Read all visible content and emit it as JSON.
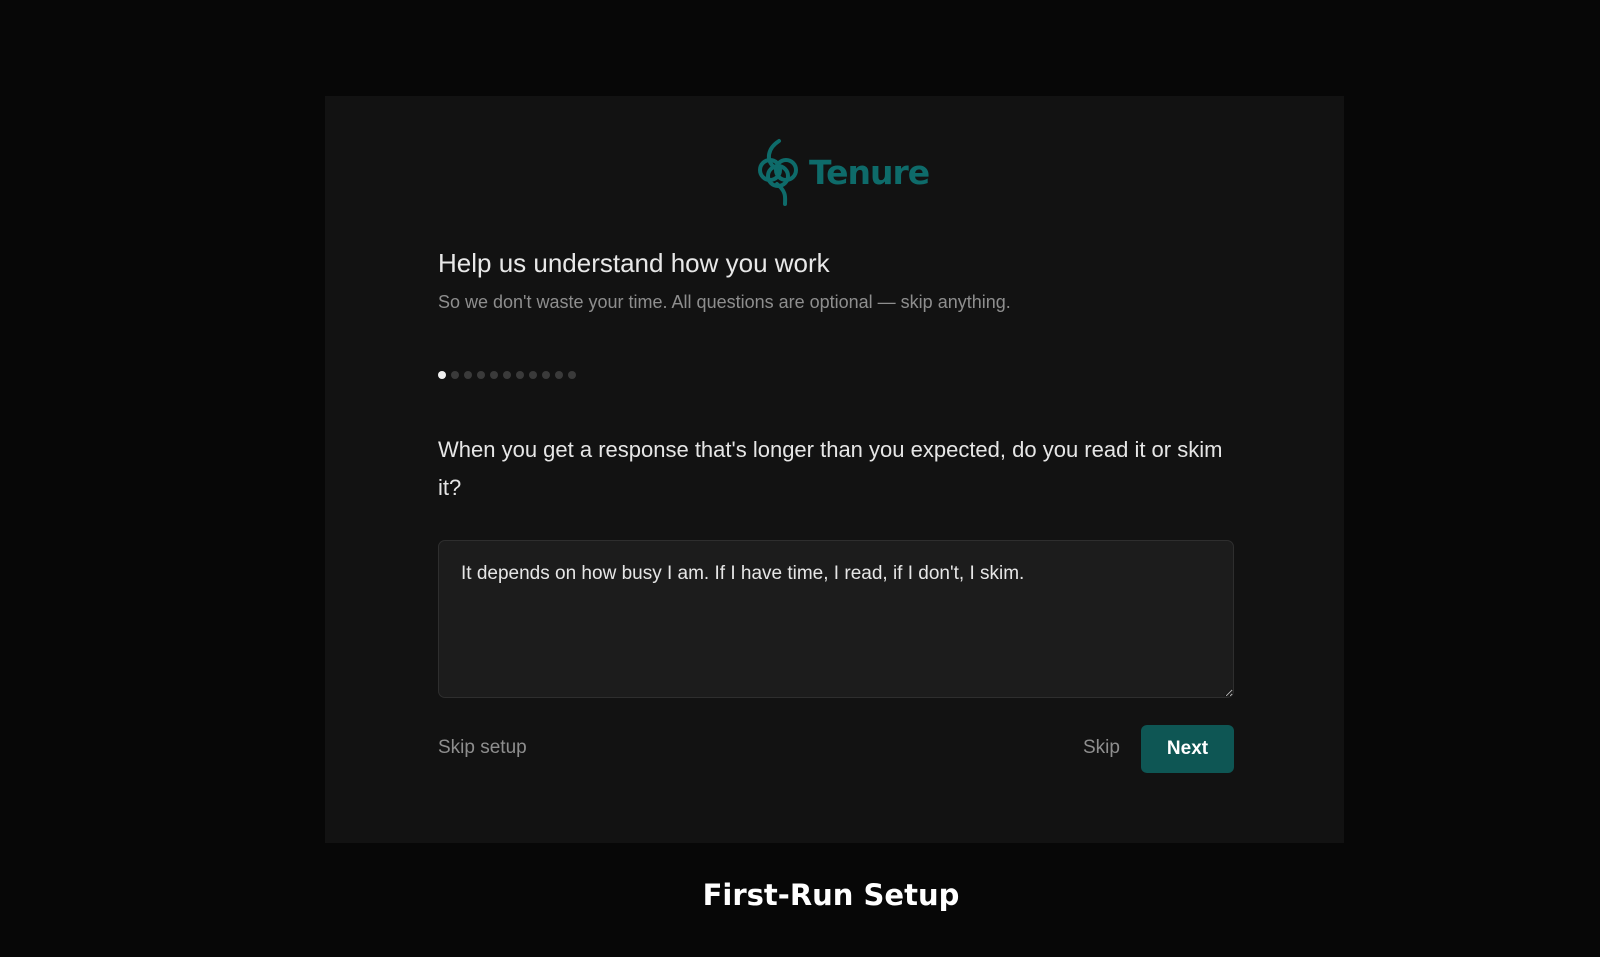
{
  "app": {
    "logo_text": "Tenure",
    "logo_icon": "tenure-knot-icon",
    "brand_color": "#0e6b6a"
  },
  "onboarding": {
    "title": "Help us understand how you work",
    "subtitle": "So we don't waste your time. All questions are optional — skip anything.",
    "progress": {
      "current_step": 1,
      "total_steps": 11
    },
    "question": "When you get a response that's longer than you expected, do you read it or skim it?",
    "answer_value": "It depends on how busy I am. If I have time, I read, if I don't, I skim."
  },
  "actions": {
    "skip_setup_label": "Skip setup",
    "skip_label": "Skip",
    "next_label": "Next",
    "accent_color": "#0e5654"
  },
  "caption": "First-Run Setup"
}
